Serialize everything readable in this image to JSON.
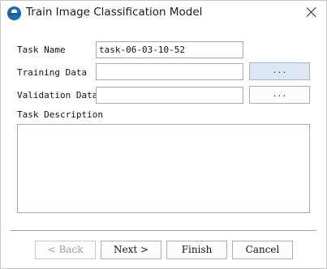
{
  "window": {
    "title": "Train Image Classification Model",
    "app_icon": "app-logo-icon",
    "close_icon": "close-icon"
  },
  "form": {
    "task_name_label": "Task Name",
    "task_name_value": "task-06-03-10-52",
    "training_data_label": "Training Data",
    "training_data_value": "",
    "training_browse_label": "...",
    "validation_data_label": "Validation Data",
    "validation_data_value": "",
    "validation_browse_label": "...",
    "task_description_label": "Task Description",
    "task_description_value": ""
  },
  "buttons": {
    "back": "< Back",
    "next": "Next >",
    "finish": "Finish",
    "cancel": "Cancel"
  }
}
